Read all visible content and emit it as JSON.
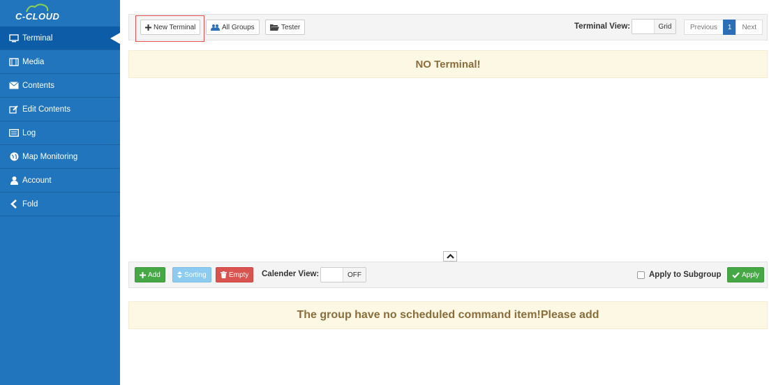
{
  "brand": {
    "name": "C-CLOUD"
  },
  "sidebar": {
    "items": [
      {
        "label": "Terminal",
        "icon": "monitor-icon",
        "active": true
      },
      {
        "label": "Media",
        "icon": "film-icon"
      },
      {
        "label": "Contents",
        "icon": "envelope-icon"
      },
      {
        "label": "Edit Contents",
        "icon": "edit-icon"
      },
      {
        "label": "Log",
        "icon": "list-icon"
      },
      {
        "label": "Map Monitoring",
        "icon": "globe-icon"
      },
      {
        "label": "Account",
        "icon": "user-icon"
      },
      {
        "label": "Fold",
        "icon": "chevron-left-icon"
      }
    ]
  },
  "top_toolbar": {
    "new_terminal": "New Terminal",
    "all_groups": "All Groups",
    "tester": "Tester",
    "terminal_view_label": "Terminal View:",
    "terminal_view_value": "Grid",
    "pager": {
      "previous": "Previous",
      "current": "1",
      "next": "Next"
    }
  },
  "notice_top": "NO Terminal!",
  "bottom_toolbar": {
    "add": "Add",
    "sorting": "Sorting",
    "empty": "Empty",
    "calendar_view_label": "Calender View:",
    "calendar_view_value": "OFF",
    "apply_to_subgroup": "Apply to Subgroup",
    "apply": "Apply"
  },
  "notice_bottom": "The group have no scheduled command item!Please add",
  "colors": {
    "sidebar": "#2175bd",
    "accent_green": "#45a845",
    "danger_red": "#d9534f",
    "notice_bg": "#fcf8e3"
  }
}
